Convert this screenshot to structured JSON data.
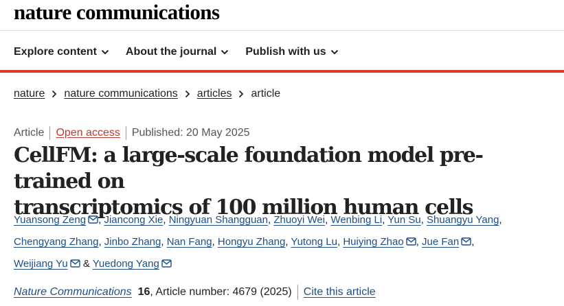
{
  "masthead": {
    "logo": "nature communications"
  },
  "nav": {
    "items": [
      {
        "label": "Explore content"
      },
      {
        "label": "About the journal"
      },
      {
        "label": "Publish with us"
      }
    ]
  },
  "breadcrumb": {
    "items": [
      "nature",
      "nature communications",
      "articles"
    ],
    "current": "article"
  },
  "meta": {
    "type": "Article",
    "access": "Open access",
    "published": "Published: 20 May 2025"
  },
  "article": {
    "title_line1": "CellFM: a large-scale foundation model pre-trained on",
    "title_line2": "transcriptomics of 100 million human cells"
  },
  "authors": {
    "line1": [
      {
        "name": "Yuansong Zeng",
        "mail": true,
        "after": ", "
      },
      {
        "name": "Jiancong Xie",
        "mail": false,
        "after": ", "
      },
      {
        "name": "Ningyuan Shangguan",
        "mail": false,
        "after": ", "
      },
      {
        "name": "Zhuoyi Wei",
        "mail": false,
        "after": ", "
      },
      {
        "name": "Wenbing Li",
        "mail": false,
        "after": ", "
      },
      {
        "name": "Yun Su",
        "mail": false,
        "after": ", "
      },
      {
        "name": "Shuangyu Yang",
        "mail": false,
        "after": ","
      }
    ],
    "line2": [
      {
        "name": "Chengyang Zhang",
        "mail": false,
        "after": ", "
      },
      {
        "name": "Jinbo Zhang",
        "mail": false,
        "after": ", "
      },
      {
        "name": "Nan Fang",
        "mail": false,
        "after": ", "
      },
      {
        "name": "Hongyu Zhang",
        "mail": false,
        "after": ", "
      },
      {
        "name": "Yutong Lu",
        "mail": false,
        "after": ", "
      },
      {
        "name": "Huiying Zhao",
        "mail": true,
        "after": ", "
      },
      {
        "name": "Jue Fan",
        "mail": true,
        "after": ","
      }
    ],
    "line3": [
      {
        "name": "Weijiang Yu",
        "mail": true,
        "after": " & "
      },
      {
        "name": "Yuedong Yang",
        "mail": true,
        "after": ""
      }
    ]
  },
  "citation": {
    "journal": "Nature Communications",
    "volume": "16",
    "rest": ", Article number: 4679 (2025)",
    "cite_link": "Cite this article"
  },
  "colors": {
    "accent_red": "#e0362c",
    "link_blue": "#1d4e89",
    "open_access": "#c0392b"
  },
  "icons": [
    "chevron-down-icon",
    "chevron-right-icon",
    "mail-icon"
  ]
}
